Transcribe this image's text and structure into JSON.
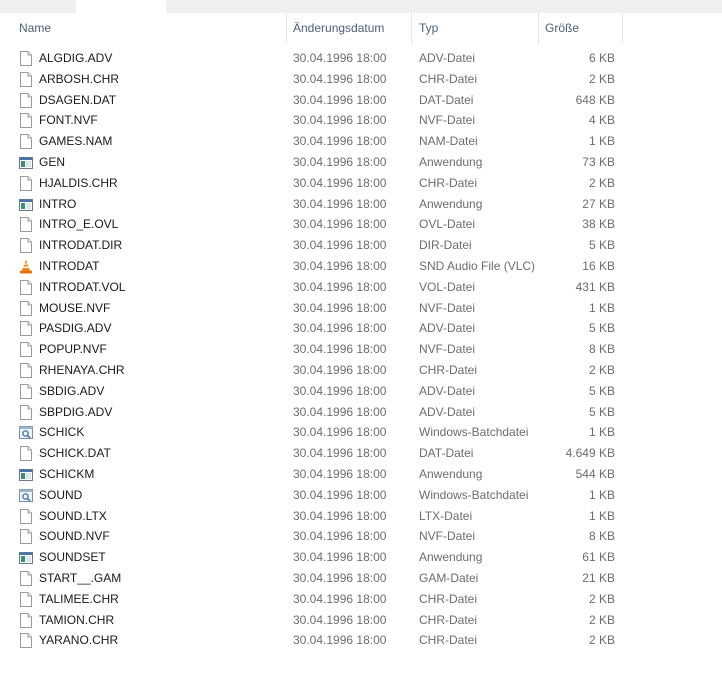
{
  "columns": {
    "name": "Name",
    "date": "Änderungsdatum",
    "type": "Typ",
    "size": "Größe"
  },
  "files": [
    {
      "name": "ALGDIG.ADV",
      "date": "30.04.1996 18:00",
      "type": "ADV-Datei",
      "size": "6 KB",
      "icon": "file-icon"
    },
    {
      "name": "ARBOSH.CHR",
      "date": "30.04.1996 18:00",
      "type": "CHR-Datei",
      "size": "2 KB",
      "icon": "file-icon"
    },
    {
      "name": "DSAGEN.DAT",
      "date": "30.04.1996 18:00",
      "type": "DAT-Datei",
      "size": "648 KB",
      "icon": "file-icon"
    },
    {
      "name": "FONT.NVF",
      "date": "30.04.1996 18:00",
      "type": "NVF-Datei",
      "size": "4 KB",
      "icon": "file-icon"
    },
    {
      "name": "GAMES.NAM",
      "date": "30.04.1996 18:00",
      "type": "NAM-Datei",
      "size": "1 KB",
      "icon": "file-icon"
    },
    {
      "name": "GEN",
      "date": "30.04.1996 18:00",
      "type": "Anwendung",
      "size": "73 KB",
      "icon": "application-icon"
    },
    {
      "name": "HJALDIS.CHR",
      "date": "30.04.1996 18:00",
      "type": "CHR-Datei",
      "size": "2 KB",
      "icon": "file-icon"
    },
    {
      "name": "INTRO",
      "date": "30.04.1996 18:00",
      "type": "Anwendung",
      "size": "27 KB",
      "icon": "application-icon"
    },
    {
      "name": "INTRO_E.OVL",
      "date": "30.04.1996 18:00",
      "type": "OVL-Datei",
      "size": "38 KB",
      "icon": "file-icon"
    },
    {
      "name": "INTRODAT.DIR",
      "date": "30.04.1996 18:00",
      "type": "DIR-Datei",
      "size": "5 KB",
      "icon": "file-icon"
    },
    {
      "name": "INTRODAT",
      "date": "30.04.1996 18:00",
      "type": "SND Audio File (VLC)",
      "size": "16 KB",
      "icon": "vlc-cone-icon"
    },
    {
      "name": "INTRODAT.VOL",
      "date": "30.04.1996 18:00",
      "type": "VOL-Datei",
      "size": "431 KB",
      "icon": "file-icon"
    },
    {
      "name": "MOUSE.NVF",
      "date": "30.04.1996 18:00",
      "type": "NVF-Datei",
      "size": "1 KB",
      "icon": "file-icon"
    },
    {
      "name": "PASDIG.ADV",
      "date": "30.04.1996 18:00",
      "type": "ADV-Datei",
      "size": "5 KB",
      "icon": "file-icon"
    },
    {
      "name": "POPUP.NVF",
      "date": "30.04.1996 18:00",
      "type": "NVF-Datei",
      "size": "8 KB",
      "icon": "file-icon"
    },
    {
      "name": "RHENAYA.CHR",
      "date": "30.04.1996 18:00",
      "type": "CHR-Datei",
      "size": "2 KB",
      "icon": "file-icon"
    },
    {
      "name": "SBDIG.ADV",
      "date": "30.04.1996 18:00",
      "type": "ADV-Datei",
      "size": "5 KB",
      "icon": "file-icon"
    },
    {
      "name": "SBPDIG.ADV",
      "date": "30.04.1996 18:00",
      "type": "ADV-Datei",
      "size": "5 KB",
      "icon": "file-icon"
    },
    {
      "name": "SCHICK",
      "date": "30.04.1996 18:00",
      "type": "Windows-Batchdatei",
      "size": "1 KB",
      "icon": "batch-file-icon"
    },
    {
      "name": "SCHICK.DAT",
      "date": "30.04.1996 18:00",
      "type": "DAT-Datei",
      "size": "4.649 KB",
      "icon": "file-icon"
    },
    {
      "name": "SCHICKM",
      "date": "30.04.1996 18:00",
      "type": "Anwendung",
      "size": "544 KB",
      "icon": "application-icon"
    },
    {
      "name": "SOUND",
      "date": "30.04.1996 18:00",
      "type": "Windows-Batchdatei",
      "size": "1 KB",
      "icon": "batch-file-icon"
    },
    {
      "name": "SOUND.LTX",
      "date": "30.04.1996 18:00",
      "type": "LTX-Datei",
      "size": "1 KB",
      "icon": "file-icon"
    },
    {
      "name": "SOUND.NVF",
      "date": "30.04.1996 18:00",
      "type": "NVF-Datei",
      "size": "8 KB",
      "icon": "file-icon"
    },
    {
      "name": "SOUNDSET",
      "date": "30.04.1996 18:00",
      "type": "Anwendung",
      "size": "61 KB",
      "icon": "application-icon"
    },
    {
      "name": "START__.GAM",
      "date": "30.04.1996 18:00",
      "type": "GAM-Datei",
      "size": "21 KB",
      "icon": "file-icon"
    },
    {
      "name": "TALIMEE.CHR",
      "date": "30.04.1996 18:00",
      "type": "CHR-Datei",
      "size": "2 KB",
      "icon": "file-icon"
    },
    {
      "name": "TAMION.CHR",
      "date": "30.04.1996 18:00",
      "type": "CHR-Datei",
      "size": "2 KB",
      "icon": "file-icon"
    },
    {
      "name": "YARANO.CHR",
      "date": "30.04.1996 18:00",
      "type": "CHR-Datei",
      "size": "2 KB",
      "icon": "file-icon"
    }
  ]
}
